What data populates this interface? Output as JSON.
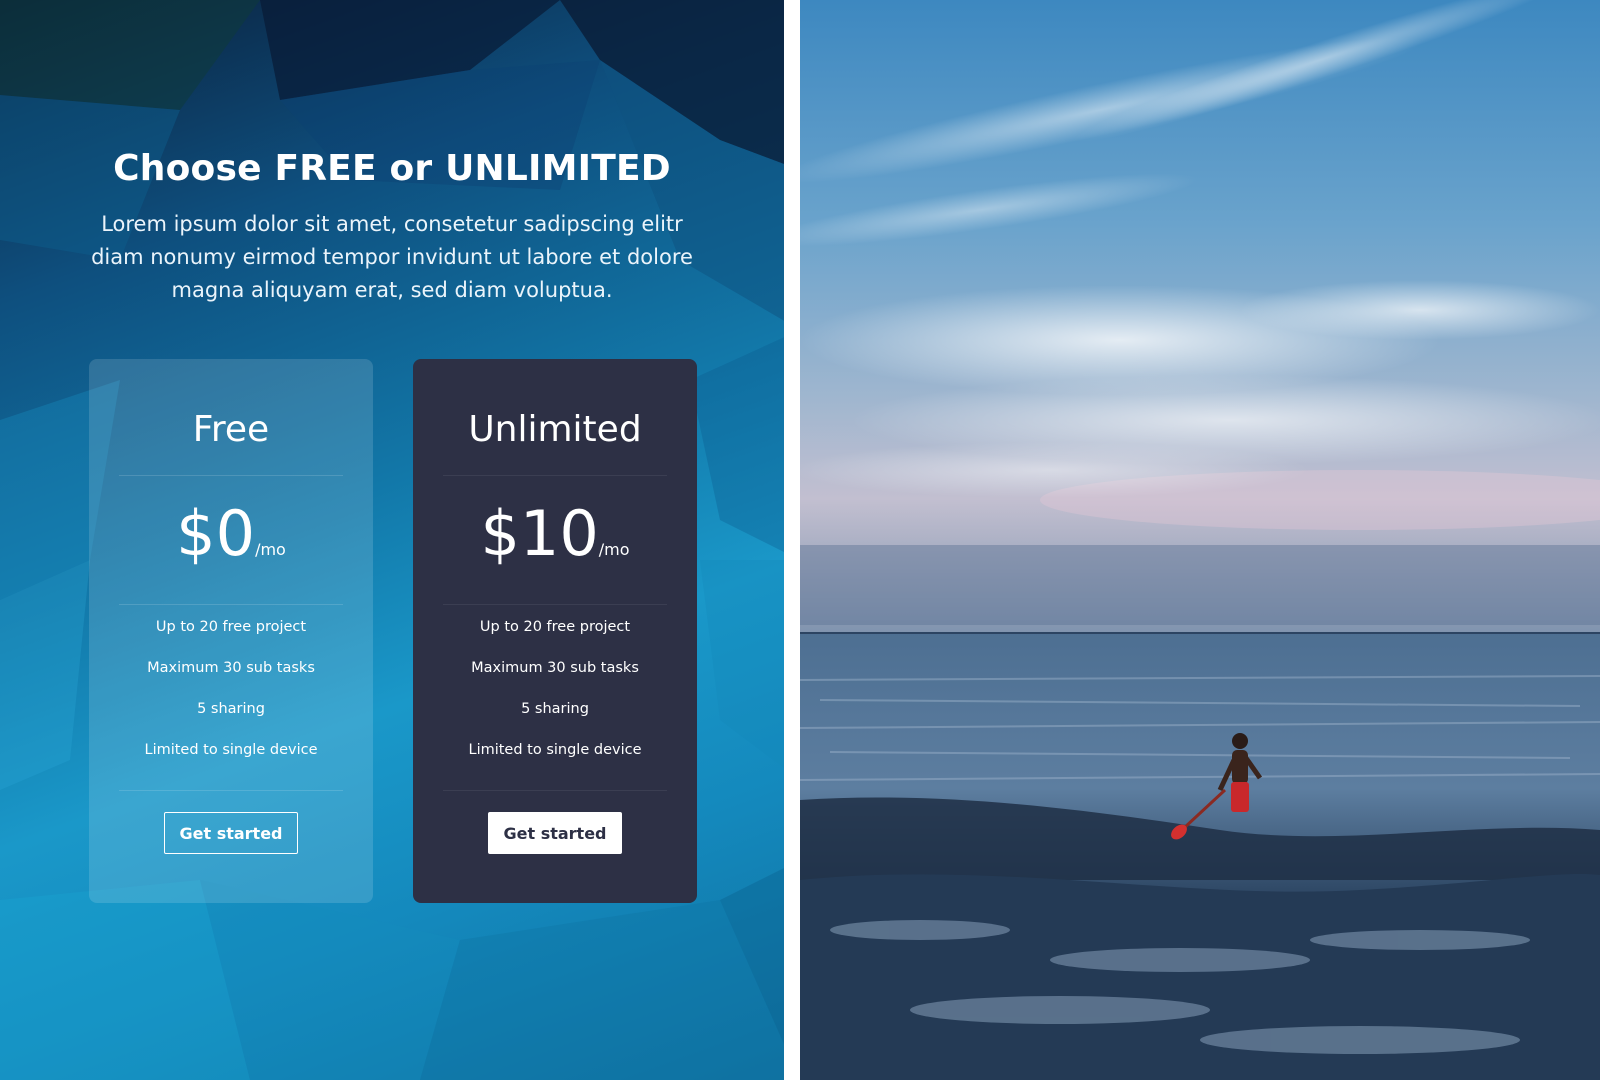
{
  "heading": "Choose FREE or UNLIMITED",
  "lead": "Lorem ipsum dolor sit amet, consetetur sadipscing elitr diam nonumy eirmod tempor invidunt ut labore et dolore magna aliquyam erat, sed diam voluptua.",
  "plans": [
    {
      "title": "Free",
      "price": "$0",
      "period": "/mo",
      "features": [
        "Up to 20 free project",
        "Maximum 30 sub tasks",
        "5 sharing",
        "Limited to single device"
      ],
      "button_label": "Get started"
    },
    {
      "title": "Unlimited",
      "price": "$10",
      "period": "/mo",
      "features": [
        "Up to 20 free project",
        "Maximum 30 sub tasks",
        "5 sharing",
        "Limited to single device"
      ],
      "button_label": "Get started"
    }
  ],
  "colors": {
    "unlimited_card": "#2d3045",
    "left_panel_blue": "#1a98c9",
    "text": "#ffffff"
  }
}
